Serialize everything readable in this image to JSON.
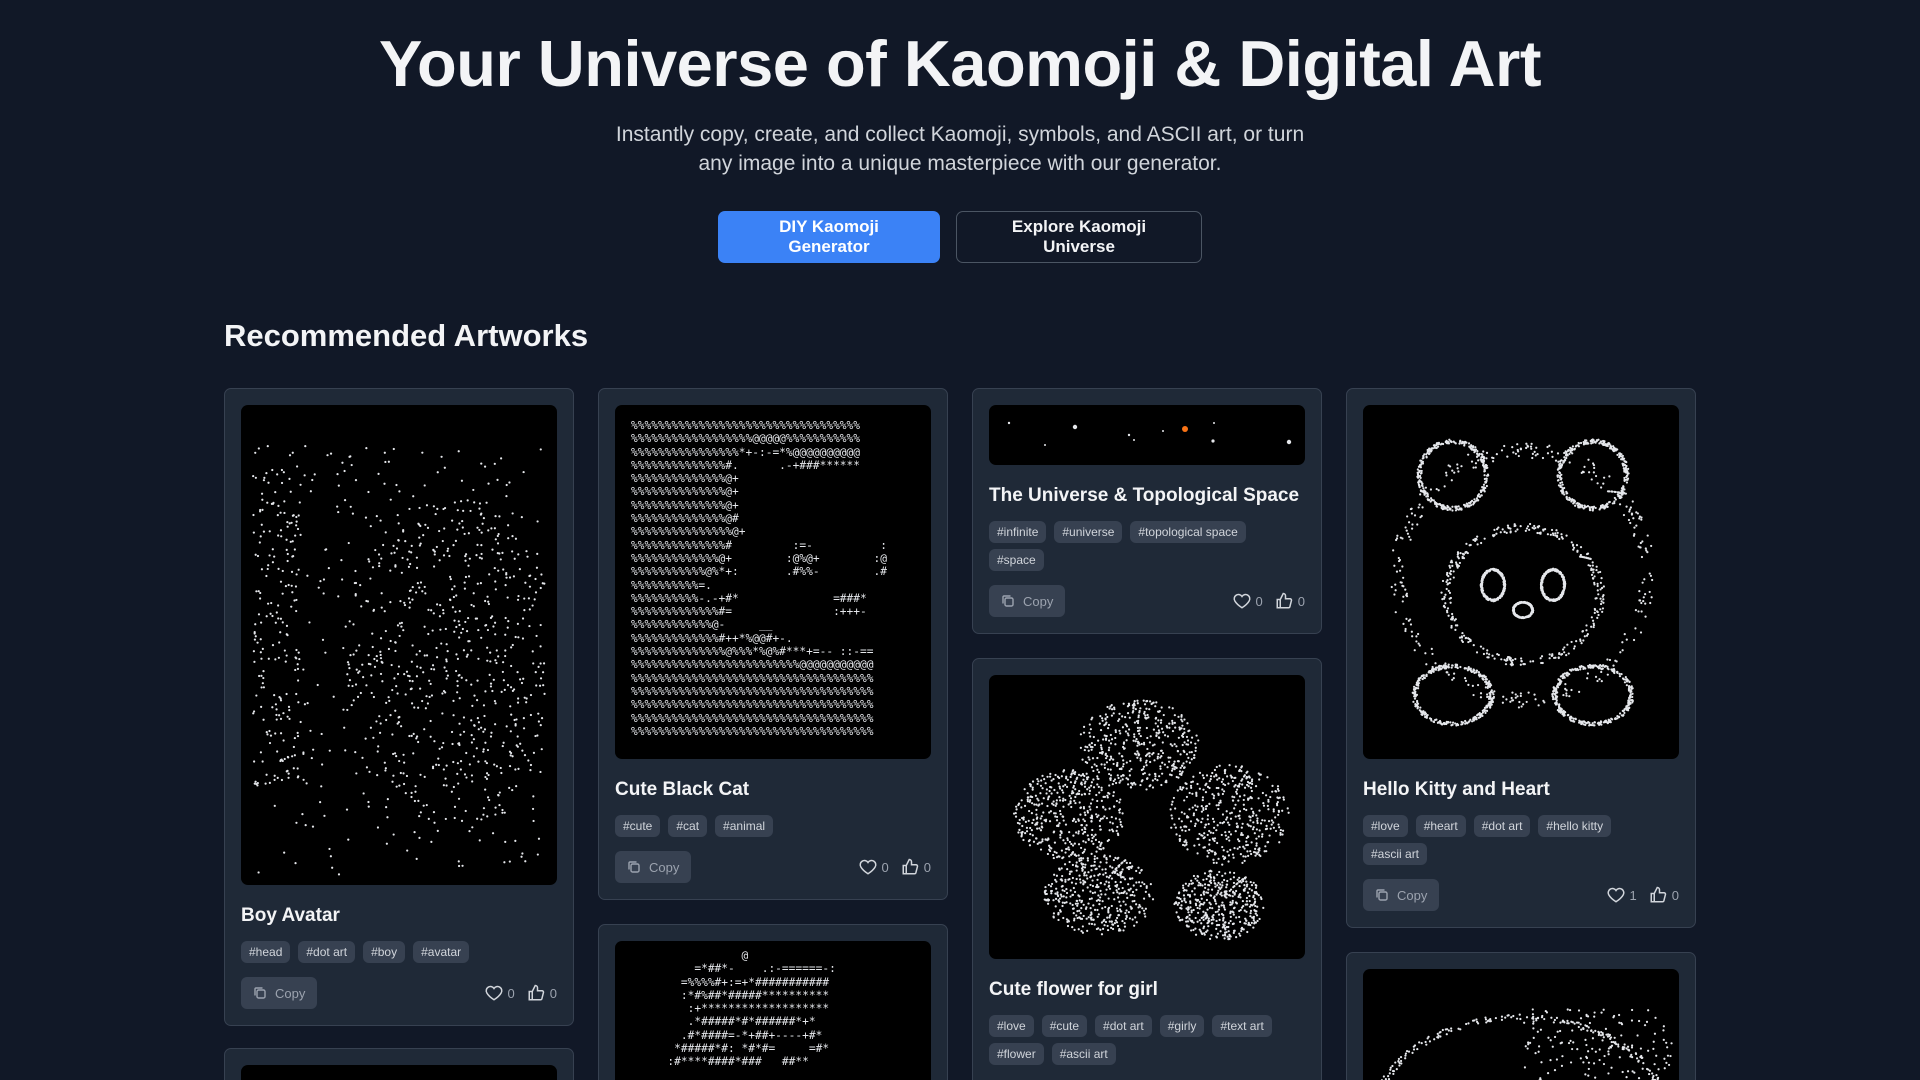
{
  "hero": {
    "title": "Your Universe of Kaomoji & Digital Art",
    "subtitle": "Instantly copy, create, and collect Kaomoji, symbols, and ASCII art, or turn any image into a unique masterpiece with our generator.",
    "primary_cta": "DIY Kaomoji Generator",
    "secondary_cta": "Explore Kaomoji Universe"
  },
  "section": {
    "title": "Recommended Artworks"
  },
  "colors": {
    "accent": "#3b82f6",
    "background": "#111827",
    "card": "#1f2937",
    "tag": "#374151"
  },
  "cards": [
    {
      "title": "Boy Avatar",
      "tags": [
        "#head",
        "#dot art",
        "#boy",
        "#avatar"
      ],
      "copy_label": "Copy",
      "likes": "0",
      "thumbs": "0"
    },
    {
      "title": "Cute Black Cat",
      "tags": [
        "#cute",
        "#cat",
        "#animal"
      ],
      "copy_label": "Copy",
      "likes": "0",
      "thumbs": "0"
    },
    {
      "title": "The Universe & Topological Space",
      "tags": [
        "#infinite",
        "#universe",
        "#topological space",
        "#space"
      ],
      "copy_label": "Copy",
      "likes": "0",
      "thumbs": "0"
    },
    {
      "title": "Hello Kitty and Heart",
      "tags": [
        "#love",
        "#heart",
        "#dot art",
        "#hello kitty",
        "#ascii art"
      ],
      "copy_label": "Copy",
      "likes": "1",
      "thumbs": "0"
    },
    {
      "title": "Cute flower for girl",
      "tags": [
        "#love",
        "#cute",
        "#dot art",
        "#girly",
        "#text art",
        "#flower",
        "#ascii art"
      ]
    }
  ],
  "ascii": {
    "cat_lines": [
      "%%%%%%%%%%%%%%%%%%%%%%%%%%%%%%%%%%",
      "%%%%%%%%%%%%%%%%%%@@@@@%%%%%%%%%%%",
      "%%%%%%%%%%%%%%%%*+-:-=*%@@@@@@@@@@",
      "%%%%%%%%%%%%%%#.      .-+###******",
      "%%%%%%%%%%%%%%@+",
      "%%%%%%%%%%%%%%@+",
      "%%%%%%%%%%%%%%@+",
      "%%%%%%%%%%%%%%@#",
      "%%%%%%%%%%%%%%%@+",
      "%%%%%%%%%%%%%%#         :=-          :",
      "%%%%%%%%%%%%%@+        :@%@+        :@",
      "%%%%%%%%%%%@%*+:       .#%%-        .#",
      "%%%%%%%%%%=.",
      "%%%%%%%%%%-.-+#*              =###*",
      "%%%%%%%%%%%%%#=               :+++-",
      "%%%%%%%%%%%%@-     __",
      "%%%%%%%%%%%%%#++*%@@#+-.",
      "%%%%%%%%%%%%%%@%%%*%@%#***+=-- ::-==",
      "%%%%%%%%%%%%%%%%%%%%%%%%%@@@@@@@@@@@",
      "%%%%%%%%%%%%%%%%%%%%%%%%%%%%%%%%%%%%",
      "%%%%%%%%%%%%%%%%%%%%%%%%%%%%%%%%%%%%",
      "%%%%%%%%%%%%%%%%%%%%%%%%%%%%%%%%%%%%",
      "%%%%%%%%%%%%%%%%%%%%%%%%%%%%%%%%%%%%",
      "%%%%%%%%%%%%%%%%%%%%%%%%%%%%%%%%%%%%"
    ],
    "bottom_lines": [
      "                 @",
      "          =*##*-    .:-======-:",
      "        =%%%%#+:=+*###########",
      "        :*#%##*#####**********",
      "         :+*******************",
      "         .*#####*#*######*+*",
      "        .#*####=-*+##+----+#*",
      "       *#####*#: *#*#=     =#*",
      "      :#****####*###   ##**"
    ]
  }
}
